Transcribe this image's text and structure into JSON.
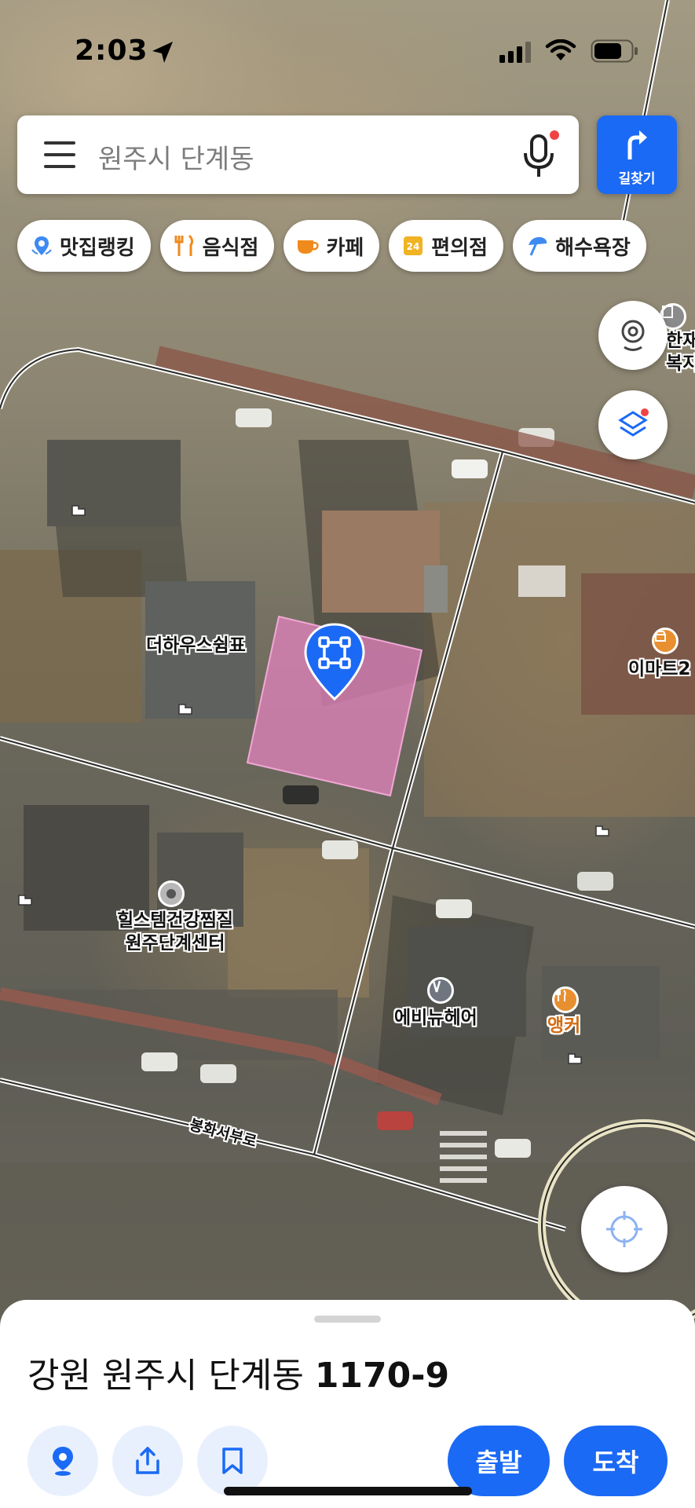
{
  "status_bar": {
    "time": "2:03",
    "icons": [
      "location-arrow-icon",
      "signal-icon",
      "wifi-icon",
      "battery-icon"
    ]
  },
  "search": {
    "query": "원주시 단계동",
    "menu_icon": "menu-icon",
    "mic_icon": "microphone-icon"
  },
  "route_button": {
    "label": "길찾기",
    "icon": "turn-right-arrow-icon"
  },
  "category_chips": [
    {
      "label": "맛집랭킹",
      "icon": "ranking-pin-icon"
    },
    {
      "label": "음식점",
      "icon": "restaurant-icon"
    },
    {
      "label": "카페",
      "icon": "cafe-icon"
    },
    {
      "label": "편의점",
      "icon": "convenience-store-icon"
    },
    {
      "label": "해수욕장",
      "icon": "beach-umbrella-icon"
    }
  ],
  "map": {
    "labels": {
      "the_house": "더하우스쉼표",
      "hills_line1": "힐스템건강찜질",
      "hills_line2": "원주단계센터",
      "eveny": "에비뉴헤어",
      "anker": "앵커",
      "emart": "이마트2",
      "welfare_line1": "한재",
      "welfare_line2": "복지센터",
      "road": "봉화서부로"
    },
    "highlight_color": "#e783c0"
  },
  "place": {
    "address_prefix": "강원 원주시 단계동",
    "address_number": "1170-9"
  },
  "actions": {
    "departure": "출발",
    "arrival": "도착"
  },
  "colors": {
    "accent": "#1b6af5",
    "chip_bg": "#ffffff",
    "sheet_icon_bg": "#e9f0fd"
  }
}
